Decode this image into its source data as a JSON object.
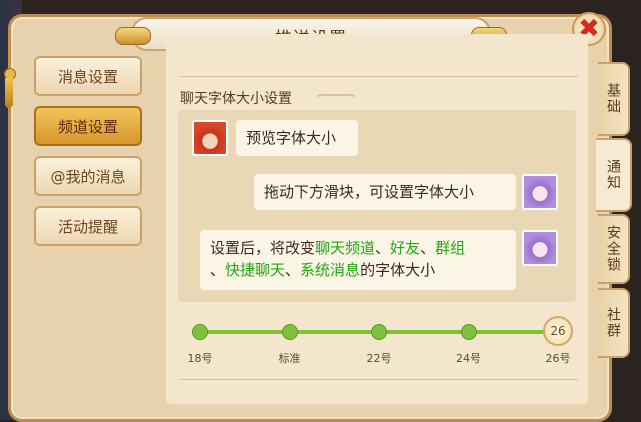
{
  "window": {
    "title": "推送设置",
    "close_label": "✖"
  },
  "menu": [
    {
      "label": "消息设置",
      "active": false
    },
    {
      "label": "频道设置",
      "active": true
    },
    {
      "label": "@我的消息",
      "active": false
    },
    {
      "label": "活动提醒",
      "active": false
    }
  ],
  "section": {
    "title": "聊天字体大小设置"
  },
  "chat": {
    "preview": "预览字体大小",
    "hint": "拖动下方滑块，可设置字体大小",
    "info_prefix": "设置后，将改变",
    "info_ch1": "聊天频道",
    "sep1": "、",
    "info_ch2": "好友",
    "sep2": "、",
    "info_ch3": "群组",
    "sep3": "、",
    "info_ch4": "快捷聊天",
    "sep4": "、",
    "info_ch5": "系统消息",
    "info_suffix": "的字体大小"
  },
  "slider": {
    "ticks": [
      "18号",
      "标准",
      "22号",
      "24号",
      "26号"
    ],
    "handle_value": "26",
    "selected_index": 4
  },
  "tabs": [
    {
      "label": "基础",
      "active": false
    },
    {
      "label": "通知",
      "active": true
    },
    {
      "label": "安全锁",
      "active": false
    },
    {
      "label": "社群",
      "active": false
    }
  ],
  "colors": {
    "highlight": "#22a416",
    "accent": "#7fc13a",
    "close": "#d62a1a"
  }
}
